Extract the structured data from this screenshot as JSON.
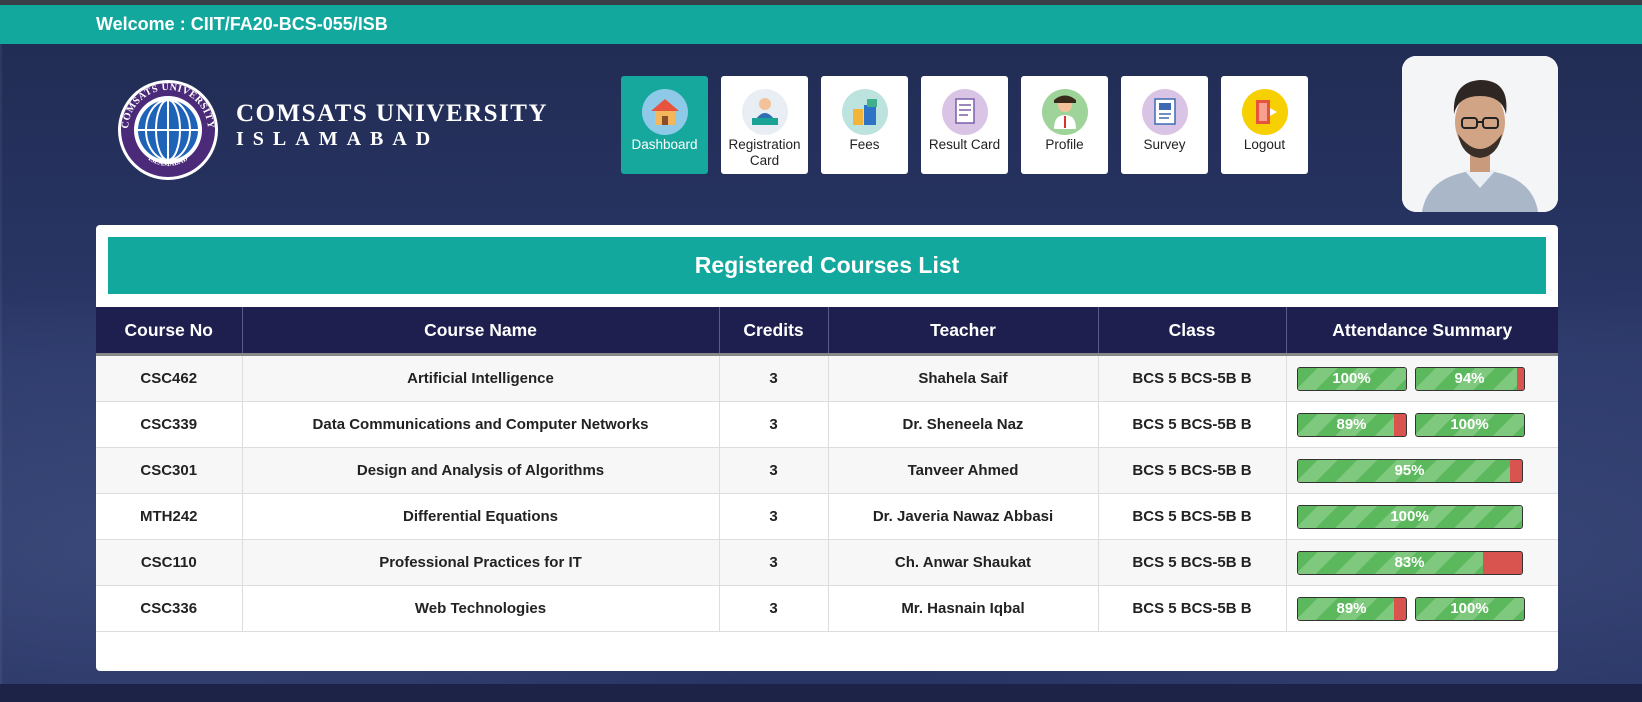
{
  "header": {
    "welcome": "Welcome : CIIT/FA20-BCS-055/ISB",
    "university_line1": "COMSATS UNIVERSITY",
    "university_line2": "ISLAMABAD",
    "logo_top_text": "COMSATS UNIVERSITY",
    "logo_bottom_text": "ISLAMABAD"
  },
  "nav": [
    {
      "label": "Dashboard",
      "icon": "house-icon",
      "active": true
    },
    {
      "label": "Registration Card",
      "icon": "student-desk-icon",
      "active": false
    },
    {
      "label": "Fees",
      "icon": "fees-icon",
      "active": false
    },
    {
      "label": "Result Card",
      "icon": "result-card-icon",
      "active": false
    },
    {
      "label": "Profile",
      "icon": "profile-person-icon",
      "active": false
    },
    {
      "label": "Survey",
      "icon": "survey-icon",
      "active": false
    },
    {
      "label": "Logout",
      "icon": "logout-door-icon",
      "active": false
    }
  ],
  "panel": {
    "title": "Registered Courses List",
    "columns": [
      "Course No",
      "Course Name",
      "Credits",
      "Teacher",
      "Class",
      "Attendance Summary"
    ],
    "rows": [
      {
        "no": "CSC462",
        "name": "Artificial Intelligence",
        "credits": "3",
        "teacher": "Shahela Saif",
        "class": "BCS 5 BCS-5B B",
        "attendance": [
          {
            "text": "100%",
            "value": 100
          },
          {
            "text": "94%",
            "value": 94
          }
        ]
      },
      {
        "no": "CSC339",
        "name": "Data Communications and Computer Networks",
        "credits": "3",
        "teacher": "Dr. Sheneela Naz",
        "class": "BCS 5 BCS-5B B",
        "attendance": [
          {
            "text": "89%",
            "value": 89
          },
          {
            "text": "100%",
            "value": 100
          }
        ]
      },
      {
        "no": "CSC301",
        "name": "Design and Analysis of Algorithms",
        "credits": "3",
        "teacher": "Tanveer Ahmed",
        "class": "BCS 5 BCS-5B B",
        "attendance": [
          {
            "text": "95%",
            "value": 95
          }
        ]
      },
      {
        "no": "MTH242",
        "name": "Differential Equations",
        "credits": "3",
        "teacher": "Dr. Javeria Nawaz Abbasi",
        "class": "BCS 5 BCS-5B B",
        "attendance": [
          {
            "text": "100%",
            "value": 100
          }
        ]
      },
      {
        "no": "CSC110",
        "name": "Professional Practices for IT",
        "credits": "3",
        "teacher": "Ch. Anwar Shaukat",
        "class": "BCS 5 BCS-5B B",
        "attendance": [
          {
            "text": "83%",
            "value": 83
          }
        ]
      },
      {
        "no": "CSC336",
        "name": "Web Technologies",
        "credits": "3",
        "teacher": "Mr. Hasnain Iqbal",
        "class": "BCS 5 BCS-5B B",
        "attendance": [
          {
            "text": "89%",
            "value": 89
          },
          {
            "text": "100%",
            "value": 100
          }
        ]
      }
    ]
  },
  "colors": {
    "teal": "#13a89e",
    "navy": "#1e1f4f",
    "present": "#5cb85c",
    "absent": "#d9534f"
  }
}
